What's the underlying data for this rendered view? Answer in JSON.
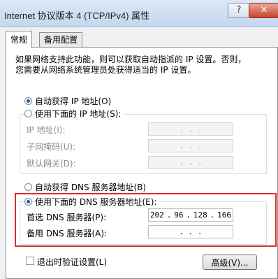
{
  "window": {
    "title": "Internet 协议版本 4 (TCP/IPv4) 属性",
    "help_label": "?",
    "close_label": "✕"
  },
  "tabs": [
    {
      "label": "常规",
      "active": true
    },
    {
      "label": "备用配置",
      "active": false
    }
  ],
  "description": {
    "line1": "如果网络支持此功能，则可以获取自动指派的 IP 设置。否则，",
    "line2": "您需要从网络系统管理员处获得适当的 IP 设置。"
  },
  "ip_section": {
    "auto_label": "自动获得 IP 地址(O)",
    "manual_label": "使用下面的 IP 地址(S):",
    "selected": "auto",
    "fields": [
      {
        "label": "IP 地址(I):",
        "value": ".   .   ."
      },
      {
        "label": "子网掩码(U):",
        "value": ".   .   ."
      },
      {
        "label": "默认网关(D):",
        "value": ".   .   ."
      }
    ]
  },
  "dns_section": {
    "auto_label": "自动获得 DNS 服务器地址(B)",
    "manual_label": "使用下面的 DNS 服务器地址(E):",
    "selected": "manual",
    "preferred_label": "首选 DNS 服务器(P):",
    "preferred_octets": [
      "202",
      "96",
      "128",
      "166"
    ],
    "alternate_label": "备用 DNS 服务器(A):",
    "alternate_value": ".   .   .",
    "highlight_color": "#e12b2b"
  },
  "footer": {
    "validate_label": "退出时验证设置(L)",
    "advanced_label": "高级(V)..."
  }
}
